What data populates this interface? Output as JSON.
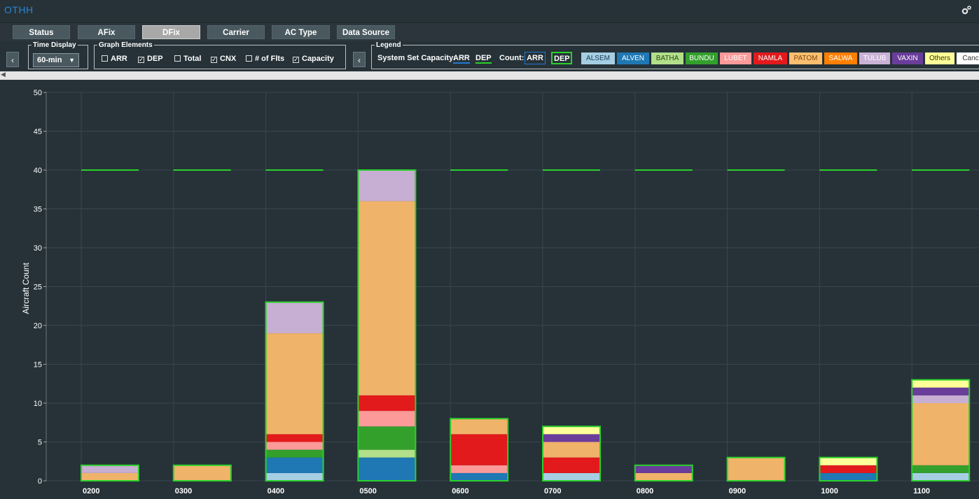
{
  "app": {
    "title": "OTHH",
    "settings_icon": "gear-icon"
  },
  "tabs": [
    {
      "label": "Status",
      "active": false
    },
    {
      "label": "AFix",
      "active": false
    },
    {
      "label": "DFix",
      "active": true
    },
    {
      "label": "Carrier",
      "active": false
    },
    {
      "label": "AC Type",
      "active": false
    },
    {
      "label": "Data Source",
      "active": false
    }
  ],
  "time_display": {
    "legend": "Time Display",
    "value": "60-min"
  },
  "graph_elements": {
    "legend": "Graph Elements",
    "items": [
      {
        "label": "ARR",
        "checked": false
      },
      {
        "label": "DEP",
        "checked": true
      },
      {
        "label": "Total",
        "checked": false
      },
      {
        "label": "CNX",
        "checked": true
      },
      {
        "label": "# of Flts",
        "checked": false
      },
      {
        "label": "Capacity",
        "checked": true
      }
    ]
  },
  "legend_panel": {
    "legend": "Legend",
    "system_capacity_label": "System Set Capacity:",
    "arr_label": "ARR",
    "dep_label": "DEP",
    "count_label": "Count:",
    "count_arr": "ARR",
    "count_dep": "DEP",
    "fixes": [
      {
        "name": "ALSEM",
        "color": "#a6cee3",
        "text": "#1a3f55"
      },
      {
        "name": "ALVEN",
        "color": "#1f78b4",
        "text": "#ffffff"
      },
      {
        "name": "BATHA",
        "color": "#b2df8a",
        "text": "#2d4a16"
      },
      {
        "name": "BUNDU",
        "color": "#33a02c",
        "text": "#ffffff"
      },
      {
        "name": "LUBET",
        "color": "#fb9a99",
        "text": "#ffffff"
      },
      {
        "name": "NAMLA",
        "color": "#e31a1c",
        "text": "#ffffff"
      },
      {
        "name": "PATOM",
        "color": "#fdbf6f",
        "text": "#7a4a10"
      },
      {
        "name": "SALWA",
        "color": "#ff7f00",
        "text": "#ffffff"
      },
      {
        "name": "TULUB",
        "color": "#cab2d6",
        "text": "#ffffff"
      },
      {
        "name": "VAXIN",
        "color": "#6a3d9a",
        "text": "#ffffff"
      },
      {
        "name": "Others",
        "color": "#ffff99",
        "text": "#333300"
      },
      {
        "name": "Canc",
        "color": "#ffffff",
        "text": "#333333"
      }
    ]
  },
  "colors": {
    "capacity_line": "#2bd12b",
    "bar_outline": "#2bd12b",
    "grid": "#3a474e",
    "ALSEM": "#a6cee3",
    "ALVEN": "#1f78b4",
    "BATHA": "#b2df8a",
    "BUNDU": "#33a02c",
    "LUBET": "#fb9a99",
    "NAMLA": "#e31a1c",
    "PATOM": "#f0b36a",
    "TULUB": "#c7aed3",
    "VAXIN": "#6a3d9a",
    "Others": "#ffff99"
  },
  "chart_data": {
    "type": "bar",
    "stacked": true,
    "ylabel": "Aircraft Count",
    "xlabel": "",
    "ylim": [
      0,
      50
    ],
    "yticks": [
      0,
      5,
      10,
      15,
      20,
      25,
      30,
      35,
      40,
      45,
      50
    ],
    "grid": true,
    "categories": [
      "0200",
      "0300",
      "0400",
      "0500",
      "0600",
      "0700",
      "0800",
      "0900",
      "1000",
      "1100"
    ],
    "capacity": [
      40,
      40,
      40,
      40,
      40,
      40,
      40,
      40,
      40,
      40
    ],
    "series": [
      {
        "name": "ALSEM",
        "values": [
          0,
          0,
          1,
          0,
          0,
          1,
          0,
          0,
          0,
          1
        ]
      },
      {
        "name": "ALVEN",
        "values": [
          0,
          0,
          2,
          3,
          1,
          0,
          0,
          0,
          1,
          0
        ]
      },
      {
        "name": "BATHA",
        "values": [
          0,
          0,
          0,
          1,
          0,
          0,
          0,
          0,
          0,
          0
        ]
      },
      {
        "name": "BUNDU",
        "values": [
          0,
          0,
          1,
          3,
          0,
          0,
          0,
          0,
          0,
          1
        ]
      },
      {
        "name": "LUBET",
        "values": [
          0,
          0,
          1,
          2,
          1,
          0,
          0,
          0,
          0,
          0
        ]
      },
      {
        "name": "NAMLA",
        "values": [
          0,
          0,
          1,
          2,
          4,
          2,
          0,
          0,
          1,
          0
        ]
      },
      {
        "name": "PATOM",
        "values": [
          1,
          2,
          13,
          25,
          2,
          2,
          1,
          3,
          0,
          8
        ]
      },
      {
        "name": "TULUB",
        "values": [
          1,
          0,
          4,
          4,
          0,
          0,
          0,
          0,
          0,
          1
        ]
      },
      {
        "name": "VAXIN",
        "values": [
          0,
          0,
          0,
          0,
          0,
          1,
          1,
          0,
          0,
          1
        ]
      },
      {
        "name": "Others",
        "values": [
          0,
          0,
          0,
          0,
          0,
          1,
          0,
          0,
          1,
          1
        ]
      }
    ]
  }
}
